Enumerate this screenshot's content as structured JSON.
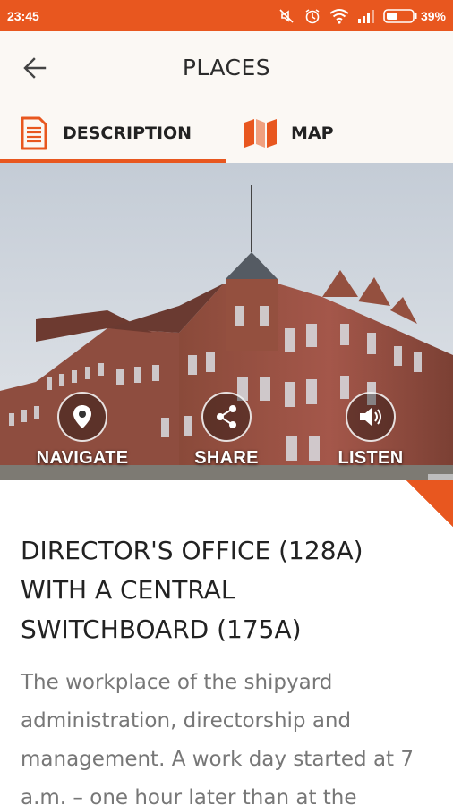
{
  "status_bar": {
    "time": "23:45",
    "battery_percent": "39%"
  },
  "app_bar": {
    "title": "PLACES"
  },
  "tabs": [
    {
      "label": "DESCRIPTION",
      "icon": "document-icon",
      "selected": true
    },
    {
      "label": "MAP",
      "icon": "folded-map-icon",
      "selected": false
    }
  ],
  "hero": {
    "actions": [
      {
        "label": "NAVIGATE",
        "icon": "location-pin-icon"
      },
      {
        "label": "SHARE",
        "icon": "share-icon"
      },
      {
        "label": "LISTEN",
        "icon": "speaker-icon"
      }
    ]
  },
  "place": {
    "title": "DIRECTOR'S OFFICE (128A) WITH A CENTRAL SWITCHBOARD (175A)",
    "description": "The workplace of the shipyard administration, directorship and management. A work day started at 7 a.m. – one hour later than at the"
  },
  "colors": {
    "accent": "#e8571f",
    "app_bar_bg": "#fbf8f4",
    "text_dark": "#222222",
    "text_muted": "#777777"
  }
}
